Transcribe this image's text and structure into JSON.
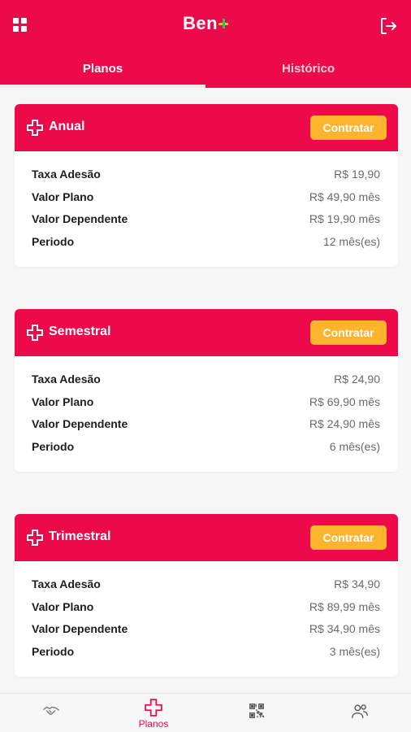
{
  "app": {
    "logo_text": "Ben"
  },
  "tabs": [
    {
      "label": "Planos",
      "active": true
    },
    {
      "label": "Histórico",
      "active": false
    }
  ],
  "plans": [
    {
      "name": "Anual",
      "button": "Contratar",
      "rows": [
        {
          "label": "Taxa Adesão",
          "value": "R$ 19,90"
        },
        {
          "label": "Valor Plano",
          "value": "R$ 49,90 mês"
        },
        {
          "label": "Valor Dependente",
          "value": "R$ 19,90 mês"
        },
        {
          "label": "Periodo",
          "value": "12 mês(es)"
        }
      ]
    },
    {
      "name": "Semestral",
      "button": "Contratar",
      "rows": [
        {
          "label": "Taxa Adesão",
          "value": "R$ 24,90"
        },
        {
          "label": "Valor Plano",
          "value": "R$ 69,90 mês"
        },
        {
          "label": "Valor Dependente",
          "value": "R$ 24,90 mês"
        },
        {
          "label": "Periodo",
          "value": "6 mês(es)"
        }
      ]
    },
    {
      "name": "Trimestral",
      "button": "Contratar",
      "rows": [
        {
          "label": "Taxa Adesão",
          "value": "R$ 34,90"
        },
        {
          "label": "Valor Plano",
          "value": "R$ 89,99 mês"
        },
        {
          "label": "Valor Dependente",
          "value": "R$ 34,90 mês"
        },
        {
          "label": "Periodo",
          "value": "3 mês(es)"
        }
      ]
    }
  ],
  "bottom_nav": [
    {
      "icon": "handshake-icon",
      "label": ""
    },
    {
      "icon": "plus-cross-icon",
      "label": "Planos",
      "active": true
    },
    {
      "icon": "qr-code-icon",
      "label": ""
    },
    {
      "icon": "users-icon",
      "label": ""
    }
  ],
  "colors": {
    "primary": "#ec0a4a",
    "accent": "#fbb42c",
    "background": "#f6f6f6"
  }
}
